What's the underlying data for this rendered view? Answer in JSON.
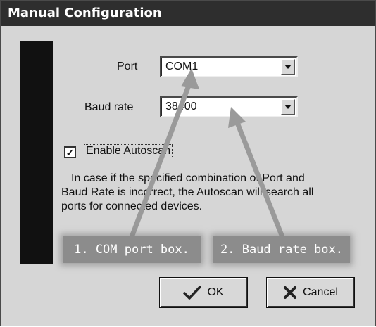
{
  "window": {
    "title": "Manual Configuration"
  },
  "port": {
    "label": "Port",
    "value": "COM1"
  },
  "baud": {
    "label": "Baud rate",
    "value": "38400"
  },
  "autoscan": {
    "checked": true,
    "label": "Enable Autoscan",
    "description_lines": [
      "In case if the specified combination of Port and",
      "Baud Rate is incorrect, the Autoscan will search all",
      "ports for connected devices."
    ]
  },
  "annotations": {
    "com_port": "1. COM port box.",
    "baud_rate": "2. Baud rate box."
  },
  "buttons": {
    "ok": "OK",
    "cancel": "Cancel"
  },
  "icons": {
    "ok": "checkmark-icon",
    "cancel": "x-icon",
    "dropdown": "chevron-down-icon"
  },
  "colors": {
    "titlebar": "#2e2e2e",
    "window_bg": "#d6d6d6",
    "annotation_bg": "#8c8c8c",
    "arrow": "#9a9a9a"
  }
}
